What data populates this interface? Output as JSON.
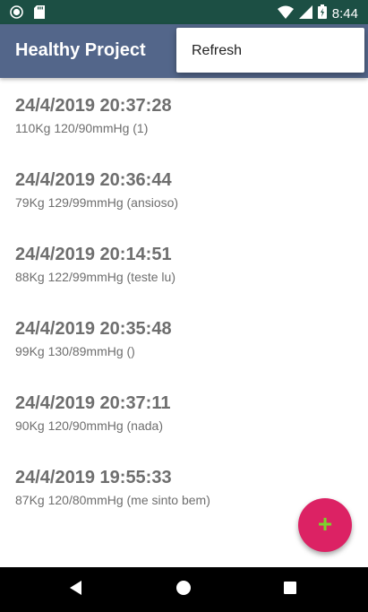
{
  "status_bar": {
    "time": "8:44",
    "icons": [
      "notification-circle-icon",
      "sd-card-icon",
      "wifi-icon",
      "cell-signal-icon",
      "battery-icon"
    ]
  },
  "app_bar": {
    "title": "Healthy Project",
    "color": "#53668a"
  },
  "overflow_menu": {
    "items": [
      {
        "label": "Refresh"
      }
    ]
  },
  "records": [
    {
      "date": "24/4/2019 20:37:28",
      "detail": "110Kg 120/90mmHg (1)"
    },
    {
      "date": "24/4/2019 20:36:44",
      "detail": "79Kg 129/99mmHg (ansioso)"
    },
    {
      "date": "24/4/2019 20:14:51",
      "detail": "88Kg 122/99mmHg (teste lu)"
    },
    {
      "date": "24/4/2019 20:35:48",
      "detail": "99Kg 130/89mmHg ()"
    },
    {
      "date": "24/4/2019 20:37:11",
      "detail": "90Kg 120/90mmHg (nada)"
    },
    {
      "date": "24/4/2019 19:55:33",
      "detail": "87Kg 120/80mmHg (me sinto bem)"
    }
  ],
  "fab": {
    "icon": "plus-icon",
    "symbol": "+",
    "color": "#dc2264",
    "icon_color": "#7cd22c"
  },
  "nav_bar": {
    "buttons": [
      "back-icon",
      "home-icon",
      "recents-icon"
    ]
  }
}
